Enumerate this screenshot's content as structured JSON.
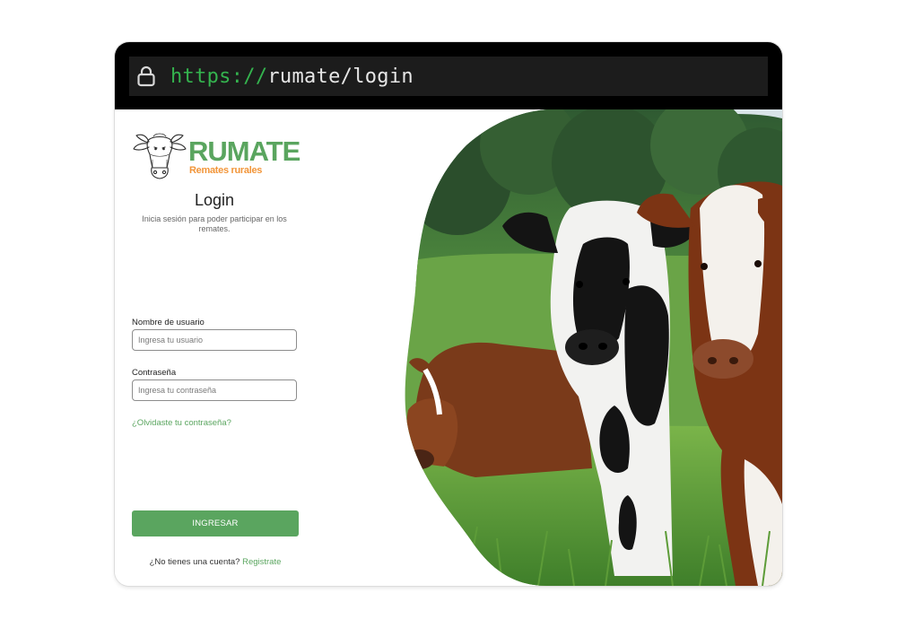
{
  "browser": {
    "url_scheme": "https://",
    "url_rest": "rumate/login",
    "lock_icon": "lock-icon"
  },
  "brand": {
    "name": "RUMATE",
    "tagline": "Remates rurales",
    "logo_icon": "cow-head-sketch",
    "primary_color": "#5aa55f",
    "accent_color": "#f29539"
  },
  "login": {
    "title": "Login",
    "subtitle": "Inicia sesión para poder participar en los remates.",
    "username_label": "Nombre de usuario",
    "username_placeholder": "Ingresa tu usuario",
    "username_value": "",
    "password_label": "Contraseña",
    "password_placeholder": "Ingresa tu contraseña",
    "password_value": "",
    "forgot_link": "¿Olvidaste tu contraseña?",
    "submit_label": "INGRESAR",
    "signup_prompt": "¿No tienes una cuenta?",
    "signup_link": "Registrate"
  },
  "hero": {
    "image_subject": "cows-in-green-pasture"
  }
}
